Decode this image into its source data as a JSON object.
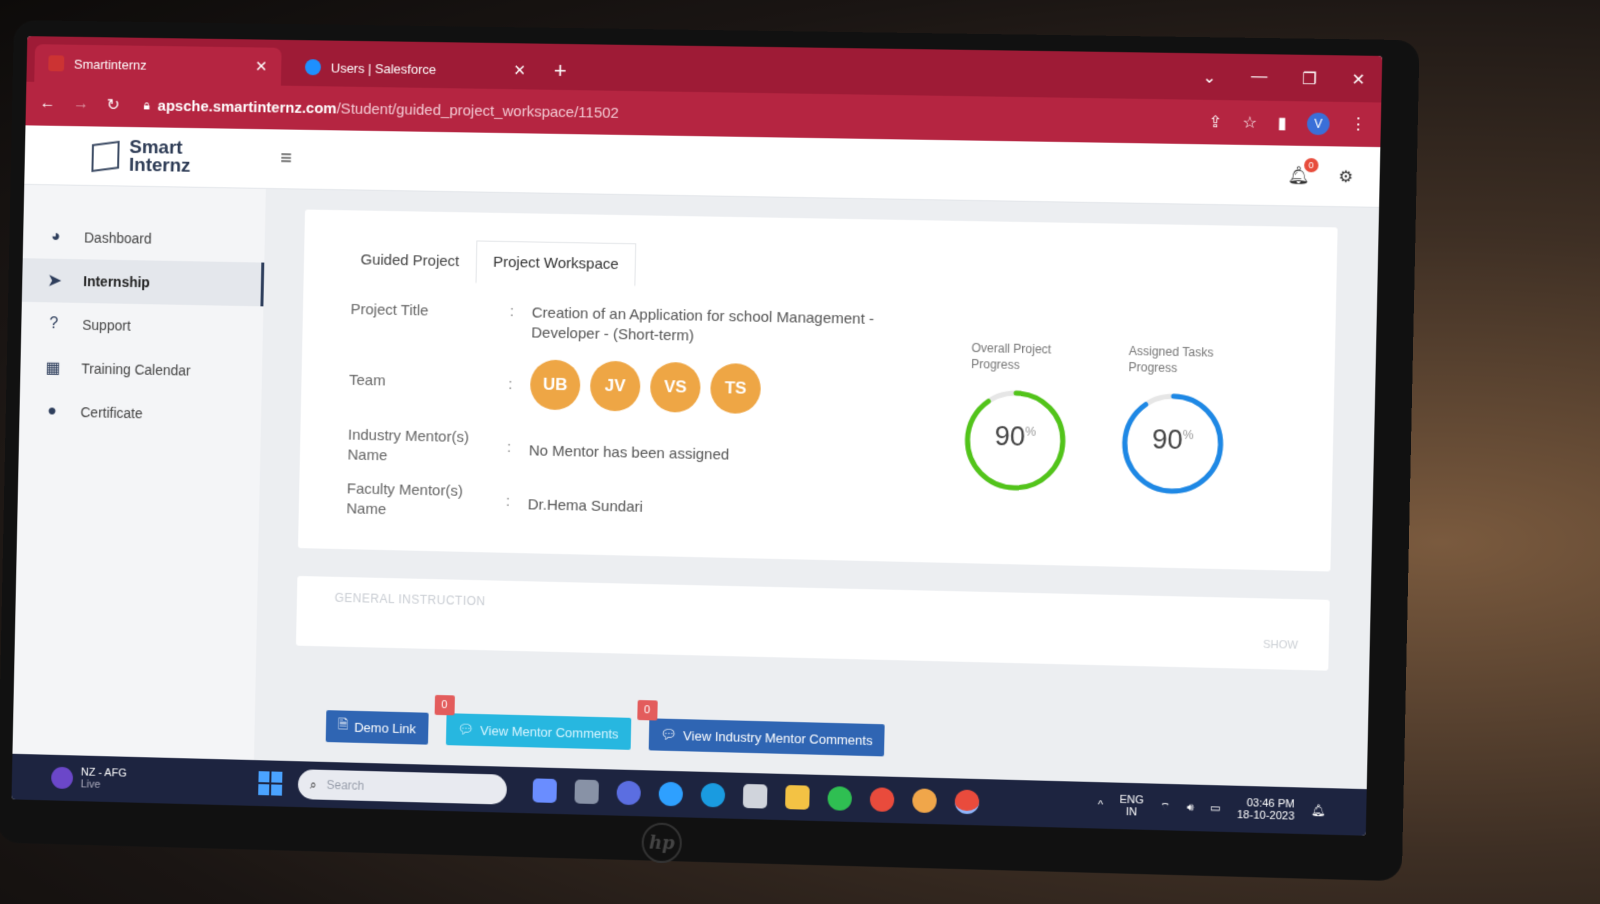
{
  "browser": {
    "tabs": [
      {
        "title": "Smartinternz",
        "active": true
      },
      {
        "title": "Users | Salesforce",
        "active": false
      }
    ],
    "url_host": "apsche.smartinternz.com",
    "url_path": "/Student/guided_project_workspace/11502",
    "profile_initial": "V"
  },
  "brand": {
    "line1": "Smart",
    "line2": "Internz"
  },
  "notifications": {
    "count": "0"
  },
  "sidebar": {
    "items": [
      {
        "label": "Dashboard",
        "icon": "dashboard-icon"
      },
      {
        "label": "Internship",
        "icon": "paper-plane-icon",
        "active": true
      },
      {
        "label": "Support",
        "icon": "question-icon"
      },
      {
        "label": "Training Calendar",
        "icon": "calendar-icon"
      },
      {
        "label": "Certificate",
        "icon": "certificate-icon"
      }
    ]
  },
  "project": {
    "tabs": [
      "Guided Project",
      "Project Workspace"
    ],
    "active_tab": "Project Workspace",
    "title_label": "Project Title",
    "title_value": "Creation of an Application for school Management - Developer - (Short-term)",
    "team_label": "Team",
    "team": [
      "UB",
      "JV",
      "VS",
      "TS"
    ],
    "industry_mentor_label_1": "Industry Mentor(s)",
    "industry_mentor_label_2": "Name",
    "industry_mentor_value": "No Mentor has been assigned",
    "faculty_mentor_label_1": "Faculty Mentor(s)",
    "faculty_mentor_label_2": "Name",
    "faculty_mentor_value": "Dr.Hema Sundari",
    "colon": ":"
  },
  "progress": {
    "overall_title_1": "Overall Project",
    "overall_title_2": "Progress",
    "overall_value": "90",
    "overall_color": "#52c41a",
    "assigned_title_1": "Assigned Tasks",
    "assigned_title_2": "Progress",
    "assigned_value": "90",
    "assigned_color": "#1e88e5",
    "unit": "%"
  },
  "general": {
    "title": "GENERAL INSTRUCTION",
    "show": "SHOW"
  },
  "actions": {
    "demo_link": "Demo Link",
    "mentor_comments": "View Mentor Comments",
    "mentor_count": "0",
    "industry_comments": "View Industry Mentor Comments",
    "industry_count": "0"
  },
  "taskbar": {
    "weather_line1": "NZ - AFG",
    "weather_line2": "Live",
    "search_placeholder": "Search",
    "lang_line1": "ENG",
    "lang_line2": "IN",
    "time": "03:46 PM",
    "date": "18-10-2023"
  },
  "device": {
    "logo": "hp"
  }
}
